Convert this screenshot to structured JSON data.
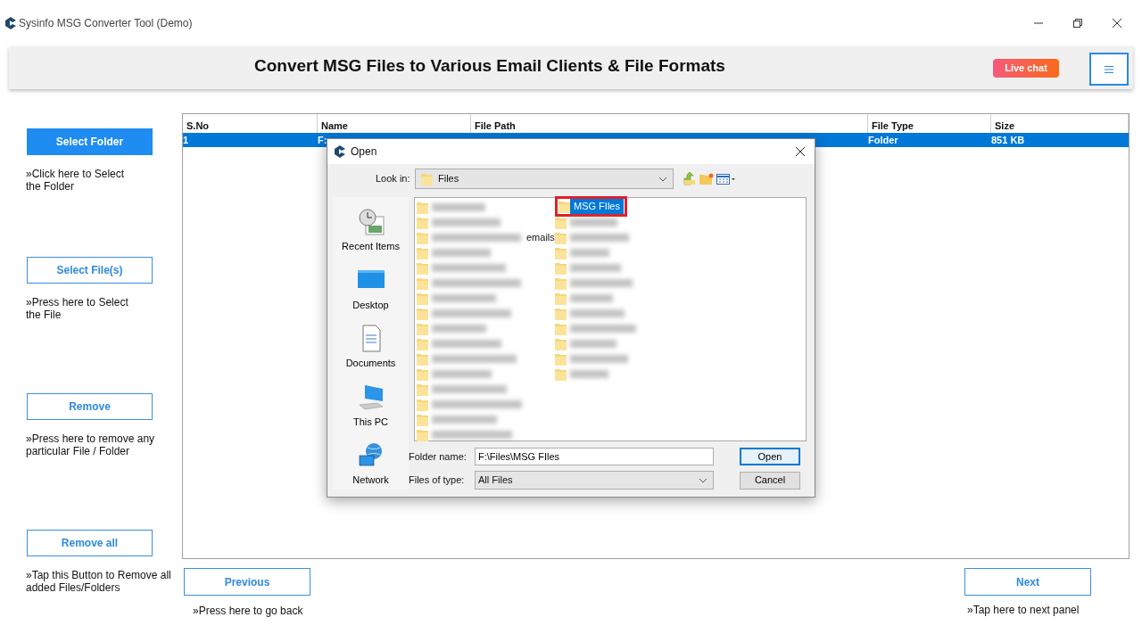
{
  "window": {
    "title": "Sysinfo MSG Converter Tool (Demo)"
  },
  "header": {
    "title": "Convert MSG Files to Various Email Clients & File Formats",
    "live_chat": "Live chat"
  },
  "actions": [
    {
      "label": "Select Folder",
      "hint": "»Click here to Select\nthe Folder",
      "primary": true
    },
    {
      "label": "Select File(s)",
      "hint": "»Press here to Select\nthe File",
      "primary": false
    },
    {
      "label": "Remove",
      "hint": "»Press here to remove any\nparticular File / Folder",
      "primary": false
    },
    {
      "label": "Remove all",
      "hint": "»Tap this Button to Remove all\nadded Files/Folders",
      "primary": false
    }
  ],
  "table": {
    "columns": [
      "S.No",
      "Name",
      "File Path",
      "File Type",
      "Size"
    ],
    "rows": [
      {
        "s_no": "1",
        "name": "F:",
        "file_type": "Folder",
        "size": "851 KB",
        "selected": true
      }
    ]
  },
  "nav": [
    {
      "label": "Previous",
      "hint": "»Press here to go back"
    },
    {
      "label": "Next",
      "hint": "»Tap here to next panel"
    }
  ],
  "dialog": {
    "title": "Open",
    "look_in_label": "Look in:",
    "look_in": "Files",
    "places": [
      {
        "kind": "recent",
        "label": "Recent Items"
      },
      {
        "kind": "desktop",
        "label": "Desktop"
      },
      {
        "kind": "documents",
        "label": "Documents"
      },
      {
        "kind": "pc",
        "label": "This PC"
      },
      {
        "kind": "network",
        "label": "Network"
      }
    ],
    "file_columns": [
      [
        {
          "kind": "blurred",
          "selected": false
        },
        {
          "kind": "blurred",
          "selected": false
        },
        {
          "kind": "blurred",
          "suffix": "emails",
          "selected": false
        },
        {
          "kind": "blurred",
          "selected": false
        },
        {
          "kind": "blurred",
          "selected": false
        },
        {
          "kind": "blurred",
          "selected": false
        },
        {
          "kind": "blurred",
          "selected": false
        },
        {
          "kind": "blurred",
          "selected": false
        },
        {
          "kind": "blurred",
          "selected": false
        },
        {
          "kind": "blurred",
          "selected": false
        },
        {
          "kind": "blurred",
          "selected": false
        },
        {
          "kind": "blurred",
          "selected": false
        },
        {
          "kind": "blurred",
          "selected": false
        },
        {
          "kind": "blurred",
          "selected": false
        },
        {
          "kind": "blurred",
          "selected": false
        },
        {
          "kind": "blurred",
          "selected": false
        }
      ],
      [
        {
          "kind": "named",
          "name": "MSG FIles",
          "selected": true
        },
        {
          "kind": "blurred",
          "selected": false
        },
        {
          "kind": "blurred",
          "selected": false
        },
        {
          "kind": "blurred",
          "selected": false
        },
        {
          "kind": "blurred",
          "selected": false
        },
        {
          "kind": "blurred",
          "selected": false
        },
        {
          "kind": "blurred",
          "selected": false
        },
        {
          "kind": "blurred",
          "selected": false
        },
        {
          "kind": "blurred",
          "selected": false
        },
        {
          "kind": "blurred",
          "selected": false
        },
        {
          "kind": "blurred",
          "selected": false
        },
        {
          "kind": "blurred",
          "selected": false
        }
      ]
    ],
    "folder_name_label": "Folder name:",
    "folder_name": "F:\\Files\\MSG FIles",
    "type_label": "Files of type:",
    "type": "All Files",
    "buttons": [
      {
        "label": "Open",
        "default": true
      },
      {
        "label": "Cancel",
        "default": false
      }
    ]
  }
}
